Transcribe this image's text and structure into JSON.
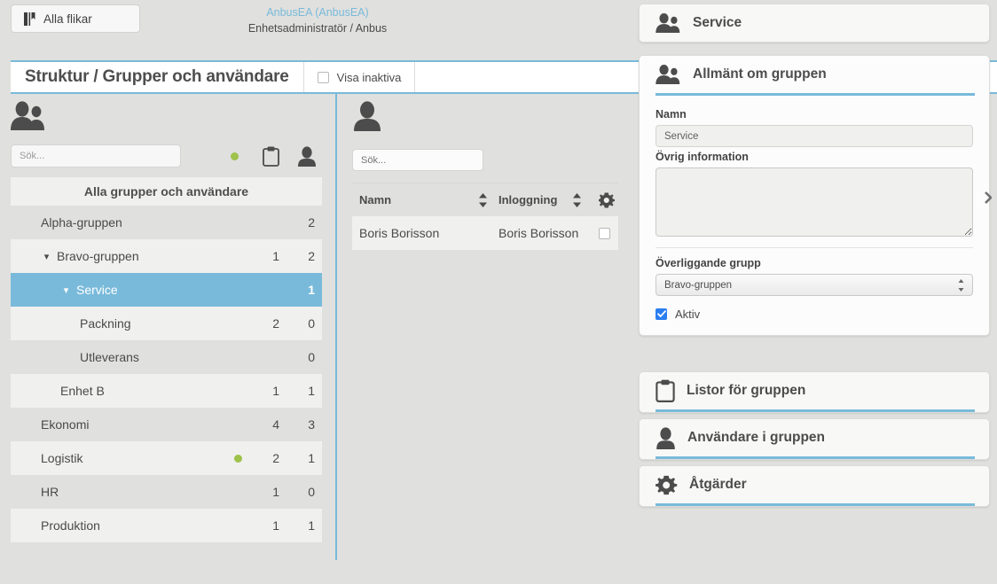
{
  "topbar": {
    "tabs_button_label": "Alla flikar",
    "tabs_button_icon": "tabs-book-icon",
    "account_name": "AnbusEA (AnbusEA)",
    "account_role": "Enhetsadministratör / Anbus"
  },
  "titlebar": {
    "title": "Struktur / Grupper och användare",
    "show_inactive_label": "Visa inaktiva",
    "show_inactive_checked": false,
    "accent_color": "#79bada"
  },
  "left_panel": {
    "header_icon": "two-people-icon",
    "search_placeholder": "Sök...",
    "search_value": "",
    "status_dot_color": "#9ec24a",
    "toolbar_icons": [
      "status-dot",
      "clipboard-icon",
      "person-icon"
    ],
    "tree_header": "Alla grupper och användare",
    "selected_row_color": "#79bada",
    "rows": [
      {
        "label": "Alpha-gruppen",
        "indent": 0,
        "chevron": "",
        "count1": "",
        "count2": "2",
        "dot": false,
        "selected": false,
        "alt": false
      },
      {
        "label": "Bravo-gruppen",
        "indent": 0,
        "chevron": "▾",
        "count1": "1",
        "count2": "2",
        "dot": false,
        "selected": false,
        "alt": true
      },
      {
        "label": "Service",
        "indent": 1,
        "chevron": "▾",
        "count1": "",
        "count2": "1",
        "dot": false,
        "selected": true,
        "alt": false
      },
      {
        "label": "Packning",
        "indent": 2,
        "chevron": "",
        "count1": "2",
        "count2": "0",
        "dot": false,
        "selected": false,
        "alt": true
      },
      {
        "label": "Utleverans",
        "indent": 2,
        "chevron": "",
        "count1": "",
        "count2": "0",
        "dot": false,
        "selected": false,
        "alt": false
      },
      {
        "label": "Enhet B",
        "indent": 1,
        "chevron": "",
        "count1": "1",
        "count2": "1",
        "dot": false,
        "selected": false,
        "alt": true
      },
      {
        "label": "Ekonomi",
        "indent": 0,
        "chevron": "",
        "count1": "4",
        "count2": "3",
        "dot": false,
        "selected": false,
        "alt": false
      },
      {
        "label": "Logistik",
        "indent": 0,
        "chevron": "",
        "count1": "2",
        "count2": "1",
        "dot": true,
        "selected": false,
        "alt": true
      },
      {
        "label": "HR",
        "indent": 0,
        "chevron": "",
        "count1": "1",
        "count2": "0",
        "dot": false,
        "selected": false,
        "alt": false
      },
      {
        "label": "Produktion",
        "indent": 0,
        "chevron": "",
        "count1": "1",
        "count2": "1",
        "dot": false,
        "selected": false,
        "alt": true
      }
    ]
  },
  "mid_panel": {
    "header_icon": "person-icon",
    "search_placeholder": "Sök...",
    "search_value": "",
    "columns": [
      "Namn",
      "Inloggning"
    ],
    "settings_icon": "gear-icon",
    "rows": [
      {
        "namn": "Boris Borisson",
        "inloggning": "Boris Borisson",
        "checked": false
      }
    ]
  },
  "right_panel": {
    "title_card": {
      "icon": "two-people-icon",
      "label": "Service"
    },
    "general_section": {
      "icon": "two-people-icon",
      "label": "Allmänt om gruppen",
      "name_label": "Namn",
      "name_value": "Service",
      "info_label": "Övrig information",
      "info_value": "",
      "parent_label": "Överliggande grupp",
      "parent_value": "Bravo-gruppen",
      "parent_options": [
        "Bravo-gruppen"
      ],
      "active_label": "Aktiv",
      "active_checked": true,
      "active_checkbox_color": "#2a7ef0"
    },
    "sections": [
      {
        "icon": "clipboard-icon",
        "label": "Listor för gruppen"
      },
      {
        "icon": "person-icon",
        "label": "Användare i gruppen"
      },
      {
        "icon": "gear-icon",
        "label": "Åtgärder"
      }
    ],
    "scroll_indicator_icon": "chevron-right-icon"
  }
}
